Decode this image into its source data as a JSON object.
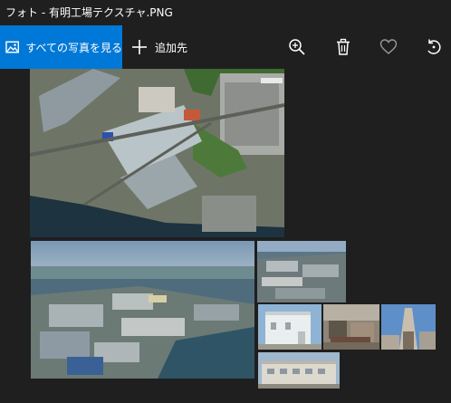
{
  "window": {
    "title": "フォト - 有明工場テクスチャ.PNG"
  },
  "toolbar": {
    "all_photos_label": "すべての写真を見る",
    "add_label": "追加先",
    "icons": [
      "photos-icon",
      "plus-icon",
      "zoom-in-icon",
      "trash-icon",
      "heart-icon",
      "rotate-icon"
    ]
  },
  "colors": {
    "accent": "#0078d7",
    "background": "#1f1f1f",
    "text": "#ffffff"
  },
  "images": [
    {
      "name": "aerial-factory-top",
      "kind": "aerial"
    },
    {
      "name": "aerial-factory-bay",
      "kind": "aerial"
    },
    {
      "name": "factory-wide-shot",
      "kind": "aerial"
    },
    {
      "name": "white-building",
      "kind": "building"
    },
    {
      "name": "industrial-interior",
      "kind": "building"
    },
    {
      "name": "chimney-structure",
      "kind": "building"
    },
    {
      "name": "low-office-building",
      "kind": "building"
    }
  ]
}
